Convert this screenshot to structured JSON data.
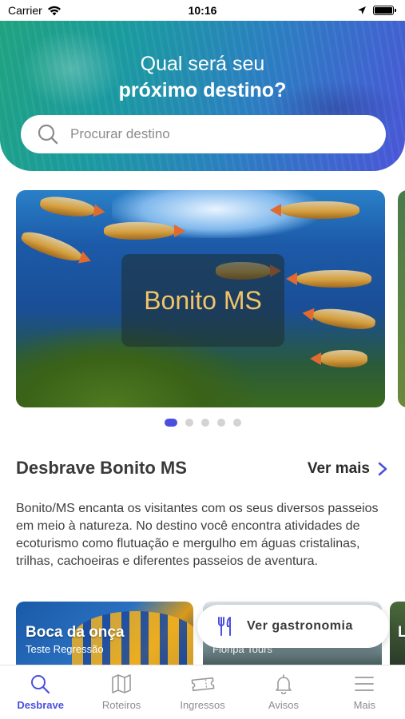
{
  "status_bar": {
    "carrier": "Carrier",
    "time": "10:16"
  },
  "header": {
    "title_line1": "Qual será seu",
    "title_line2": "próximo destino?",
    "search_placeholder": "Procurar destino"
  },
  "carousel": {
    "current_title": "Bonito MS",
    "slide_count": 5,
    "active_index": 0
  },
  "section": {
    "title": "Desbrave Bonito MS",
    "see_more": "Ver mais",
    "description": "Bonito/MS encanta os visitantes com os seus diversos passeios em meio à natureza. No destino você encontra atividades de ecoturismo como flutuação e mergulho em águas cristalinas, trilhas, cachoeiras e diferentes passeios de aventura."
  },
  "cards": [
    {
      "title": "Boca da onça",
      "subtitle": "Teste Regressão"
    },
    {
      "title": "",
      "subtitle": "Floripa Tours"
    },
    {
      "title": "L",
      "subtitle": ""
    }
  ],
  "fab": {
    "label": "Ver gastronomia",
    "icon": "cutlery-icon"
  },
  "tab_bar": {
    "items": [
      {
        "label": "Desbrave",
        "icon": "search-icon",
        "active": true
      },
      {
        "label": "Roteiros",
        "icon": "map-icon",
        "active": false
      },
      {
        "label": "Ingressos",
        "icon": "ticket-icon",
        "active": false
      },
      {
        "label": "Avisos",
        "icon": "bell-icon",
        "active": false
      },
      {
        "label": "Mais",
        "icon": "menu-icon",
        "active": false
      }
    ]
  },
  "colors": {
    "accent": "#4a4fe0",
    "carousel_title": "#f2c469"
  }
}
